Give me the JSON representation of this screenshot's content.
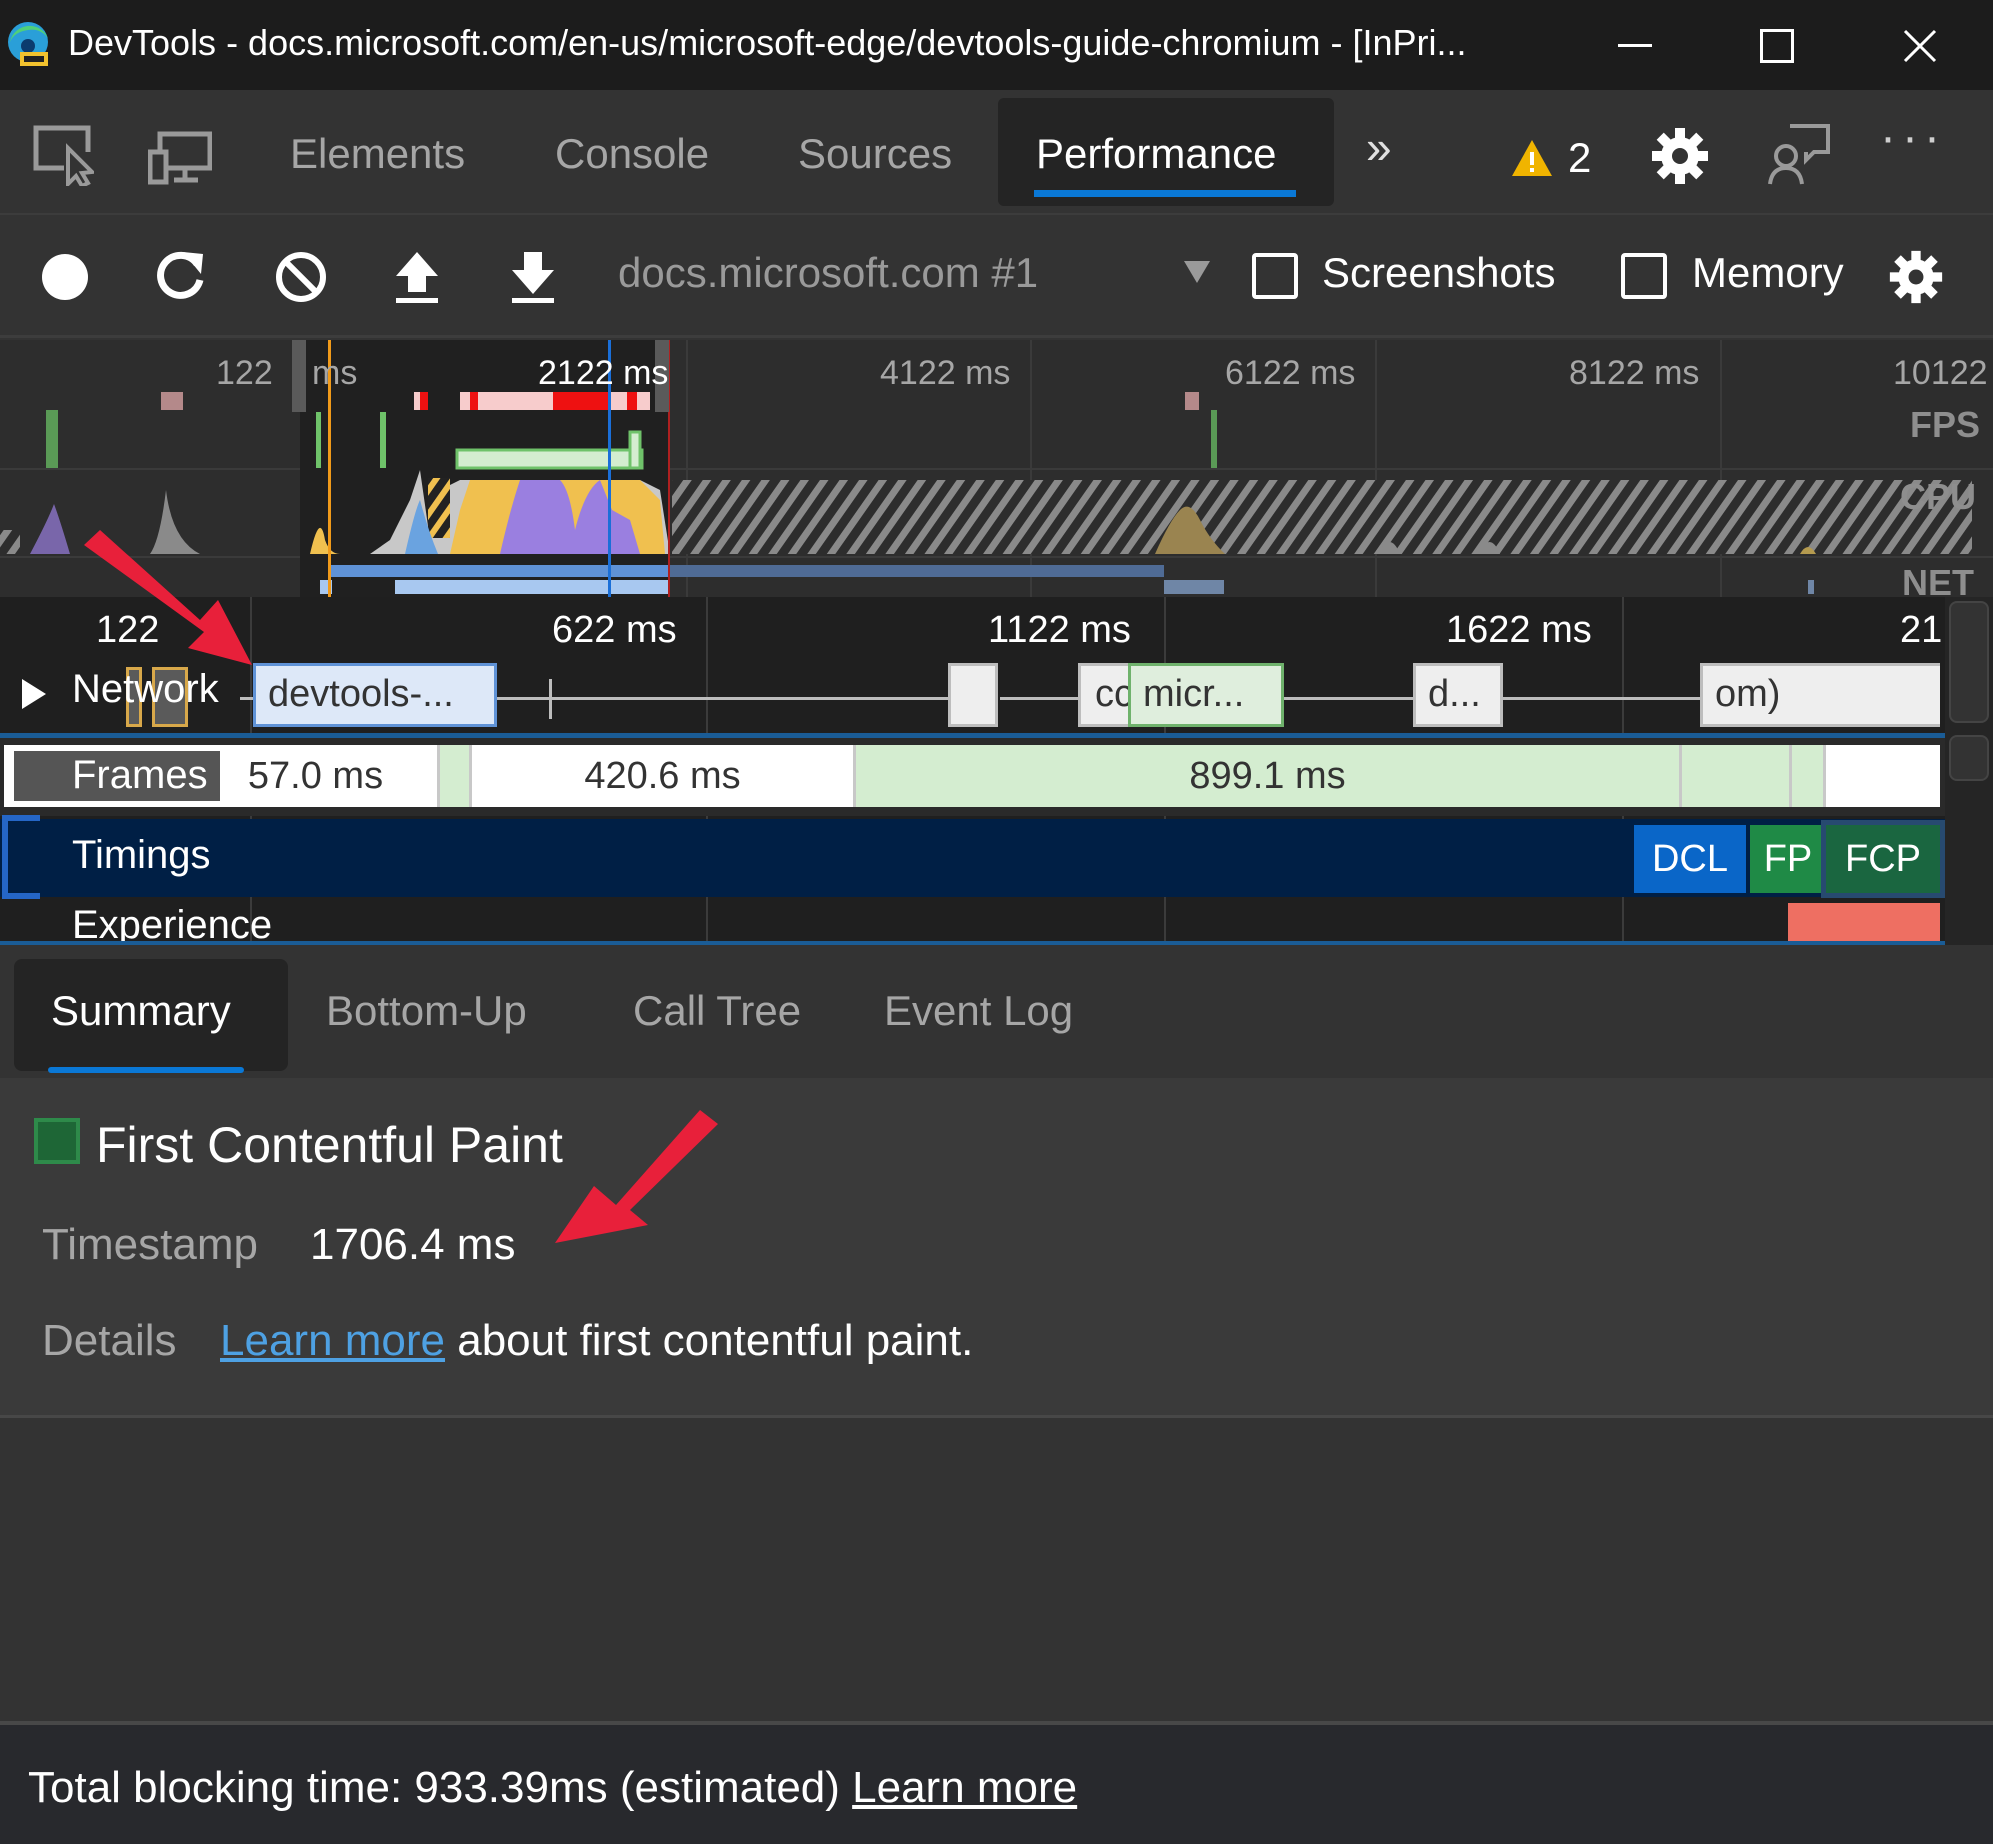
{
  "window": {
    "title": "DevTools - docs.microsoft.com/en-us/microsoft-edge/devtools-guide-chromium - [InPri...",
    "minimize_icon": "minimize-icon",
    "maximize_icon": "maximize-icon",
    "close_icon": "close-icon"
  },
  "main_tabs": {
    "items": [
      {
        "label": "Elements"
      },
      {
        "label": "Console"
      },
      {
        "label": "Sources"
      },
      {
        "label": "Performance",
        "active": true
      }
    ],
    "more_tabs": "»",
    "warning_count": "2",
    "icons": [
      "inspect-element-icon",
      "device-emulation-icon",
      "more-tabs-icon",
      "warning-icon",
      "settings-icon",
      "feedback-icon",
      "more-options-icon"
    ],
    "more_options": "···"
  },
  "toolbar": {
    "icons": [
      "record-icon",
      "reload-record-icon",
      "clear-icon",
      "upload-profile-icon",
      "download-profile-icon"
    ],
    "profile_select": "docs.microsoft.com #1",
    "screenshots_label": "Screenshots",
    "screenshots_checked": false,
    "memory_label": "Memory",
    "memory_checked": false
  },
  "overview": {
    "ticks": [
      "122",
      "ms",
      "2122 ms",
      "4122 ms",
      "6122 ms",
      "8122 ms",
      "10122"
    ],
    "labels": {
      "fps": "FPS",
      "cpu": "CPU",
      "net": "NET"
    },
    "colors": {
      "scripting": "#f0c04f",
      "rendering": "#9a7fe0",
      "painting": "#6fb26c",
      "system": "#c8c8c8",
      "loading": "#6aa3e0"
    }
  },
  "timeline": {
    "ruler": [
      "122",
      "622 ms",
      "1122 ms",
      "1622 ms",
      "21"
    ],
    "network": {
      "label": "Network",
      "requests": [
        {
          "label": "devtools-..."
        },
        {
          "label": ""
        },
        {
          "label": "cc"
        },
        {
          "label": "micr..."
        },
        {
          "label": "d..."
        },
        {
          "label": "om)"
        }
      ]
    },
    "frames": {
      "label": "Frames",
      "durations": [
        "57.0 ms",
        "420.6 ms",
        "899.1 ms"
      ]
    },
    "timings": {
      "label": "Timings",
      "markers": [
        {
          "label": "DCL",
          "color": "#0a66c8"
        },
        {
          "label": "FP",
          "color": "#1f8a46"
        },
        {
          "label": "FCP",
          "color": "#1a6640"
        }
      ]
    },
    "experience": {
      "label": "Experience"
    }
  },
  "bottom_tabs": {
    "items": [
      {
        "label": "Summary",
        "active": true
      },
      {
        "label": "Bottom-Up"
      },
      {
        "label": "Call Tree"
      },
      {
        "label": "Event Log"
      }
    ]
  },
  "summary": {
    "title": "First Contentful Paint",
    "swatch_color": "#1e6636",
    "timestamp_label": "Timestamp",
    "timestamp_value": "1706.4 ms",
    "details_label": "Details",
    "details_link": "Learn more",
    "details_text": " about first contentful paint."
  },
  "footer": {
    "text": "Total blocking time: 933.39ms (estimated) ",
    "link": "Learn more"
  },
  "annotations": {
    "arrow_color": "#e8203a"
  }
}
